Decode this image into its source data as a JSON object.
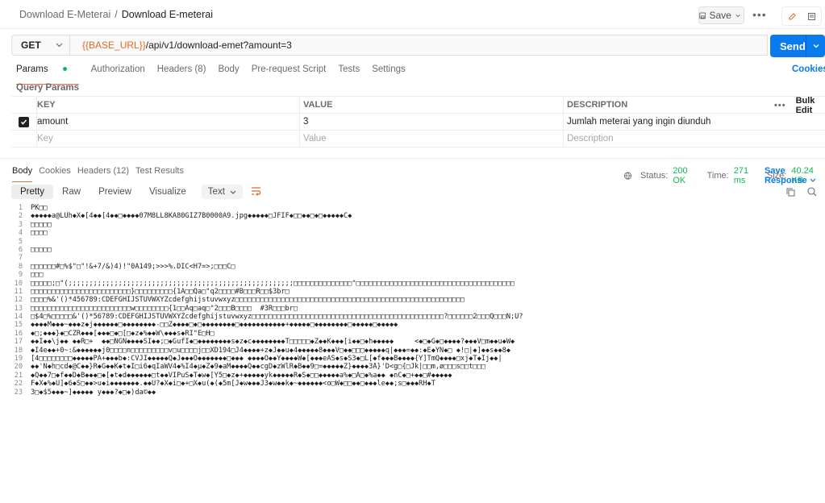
{
  "breadcrumb": {
    "parent": "Download E-Meterai",
    "separator": "/",
    "current": "Download E-meterai"
  },
  "toolbar": {
    "save_label": "Save",
    "more": "•••"
  },
  "request": {
    "method": "GET",
    "url_variable": "{{BASE_URL}}",
    "url_path": "/api/v1/download-emet?amount=3",
    "send_label": "Send"
  },
  "request_tabs": [
    "Params",
    "Authorization",
    "Headers (8)",
    "Body",
    "Pre-request Script",
    "Tests",
    "Settings"
  ],
  "cookies_label": "Cookies",
  "query_params": {
    "title": "Query Params",
    "headers": {
      "key": "KEY",
      "value": "VALUE",
      "description": "DESCRIPTION",
      "more": "•••",
      "bulk": "Bulk Edit"
    },
    "rows": [
      {
        "key": "amount",
        "value": "3",
        "description": "Jumlah meterai yang ingin diunduh"
      }
    ],
    "placeholder": {
      "key": "Key",
      "value": "Value",
      "description": "Description"
    }
  },
  "response_tabs": [
    "Body",
    "Cookies",
    "Headers (12)",
    "Test Results"
  ],
  "status": {
    "status_label": "Status:",
    "status_value": "200 OK",
    "time_label": "Time:",
    "time_value": "271 ms",
    "size_label": "Size:",
    "size_value": "40.24 KB"
  },
  "save_response_label": "Save Response",
  "format_tabs": [
    "Pretty",
    "Raw",
    "Preview",
    "Visualize"
  ],
  "format_type": "Text",
  "colors": {
    "accent": "#097bed",
    "orange": "#f26b3a",
    "green": "#0cbb52"
  },
  "body_lines": [
    "PK□□",
    "◆◆◆◆◆a@LUh◆X◆[4◆◆[4◆◆□◆◆◆◆07M8LL8KA80GIZ7B0000A9.jpg◆◆◆◆◆□JFIF◆□□◆◆□◆□◆◆◆◆◆C◆",
    "□□□□□",
    "□□□□",
    "",
    "□□□□□",
    "",
    "□□□□□□#□%$\"□\"!&+7/&)4)!\"0A149;>>>%.DIC<H7=>;□□□C□",
    "□□□",
    "□□□□□;□\"(;;;;;;;;;;;;;;;;;;;;;;;;;;;;;;;;;;;;;;;;;;;;;;;;;;;;;;□□□□□□□□□□□□□□\"□□□□□□□□□□□□□□□□□□□□□□□□□□□□□□□□□□□□□□",
    "□□□□□□□□□□□□□□□□□□□□□□□□}□□□□□□□□□{1A□□Qa□\"q2□□□□#B□□□R□□$3br□",
    "□□□□%&'()*456789:CDEFGHIJSTUVWXYZcdefghijstuvwxyz□□□□□□□□□□□□□□□□□□□□□□□□□□□□□□□□□□□□□□□□□□□□□□□□□□□□□□□",
    "□□□□□□□□□□□□□□□□□□□□□□□□w□□□□□□□□{1□□Aq□aq□\"2□□□B□□□□  #3R□□□br□",
    "□$4□%□□□□□&'()*56789:CDEFGHIJSTUVWXYZcdefghijstuvwxyz□□□□□□□□□□□□□□□□□□□□□□□□□□□□□□□□□□□□□□□□□□□□□□?□□□□□□2□□□Q□□□N;U?",
    "◆◆◆◆M◆◆◆~◆◆◆z◆j◆◆◆◆◆◆□◆◆◆◆◆◆◆◆-□□Z◆◆◆◆□◆□◆◆◆◆◆◆◆◆□◆◆◆◆◆◆◆◆◆◆◆+◆◆◆◆◆□◆◆◆◆◆◆◆◆□◆◆◆◆◆□◆◆◆◆◆",
    "◆□;◆◆◆}◆□CZR◆◆◆[◆◆◆□◆□[□◆z◆%◆◆W\\◆◆◆s◆RI\"E□H□",
    "◆◆I◆◆\\j◆◆ ◆◆R□+  ◆◆□NGN◆◆◆◆SI◆◆;□◆GufI◆□◆◆◆◆◆◆◆◆s◆z◆c◆◆◆◆◆◆◆◆T□□□□□◆Z◆◆K◆◆◆[i◆◆□◆h◆◆◆◆◆     <◆□◆G◆□◆◆◆◆?◆◆◆V□m◆◆u◆W◆",
    "◆I4e◆◆+0~:&◆◆◆◆◆◆j0□□□□n□□□□□□□□□v□u□□□□j□□XD194□J4◆◆◆◆+z◆J◆◆u◆4◆◆◆◆◆8◆◆◆V□◆◆□□□◆◆◆◆◆q|◆◆◆=◆◆:◆E◆YN◆□ ◆!□|◆]◆◆s◆◆8◆",
    "[4□□□□□□□□◆◆◆◆◆PA+◆◆◆b◆:CVJI◆◆◆◆◆Q◆J◆◆◆O◆◆◆◆◆◆◆□◆◆◆ ◆◆◆◆O◆◆Y◆◆◆◆W◆[◆◆◆eAS◆s◆S3◆□L[◆f◆◆◆B◆◆◆◆{Y]TmQ◆◆◆◆□xj◆T◆Ij◆◆|",
    "◆◆'N◆h□cd◆@C◆◆}R◆G◆◆K◆t◆I□i6◆qIaWV4◆%I4◆µ◆Z◆9◆aM◆◆◆◆Q◆◆cgD◆zWlR◆B◆◆9□=◆◆◆◆◆Z}◆◆◆◆3Å}'D<g□{□Jk|□□m,ø□□□s□□t□□□",
    "◆Q◆◆7□◆f◆◆D◆B◆◆◆□◆[◆t◆d◆◆◆◆◆◆□t◆◆VIPuS◆T◆w◆[Y5□◆z◆+◆◆◆◆◆yk◆◆◆◆◆R◆S◆□□◆◆◆◆◆a%◆□A□◆%a◆◆ ◆nC◆□+◆◆□#◆◆◆◆◆",
    "F◆X◆%◆U]◆6◆S□◆◆>u◆i◆◆◆◆◆◆◆.◆◆U?◆X◆i□◆+□X◆u(◆(◆5m[J◆w◆◆◆J3◆w◆◆k◆~◆◆◆◆◆◆<o□W◆□□◆◆□◆◆◆le◆◆;s□◆◆◆RH◆T",
    "3□◆$5◆◆◆~]◆◆◆◆◆ y◆◆◆?◆□◆)da©◆◆"
  ]
}
